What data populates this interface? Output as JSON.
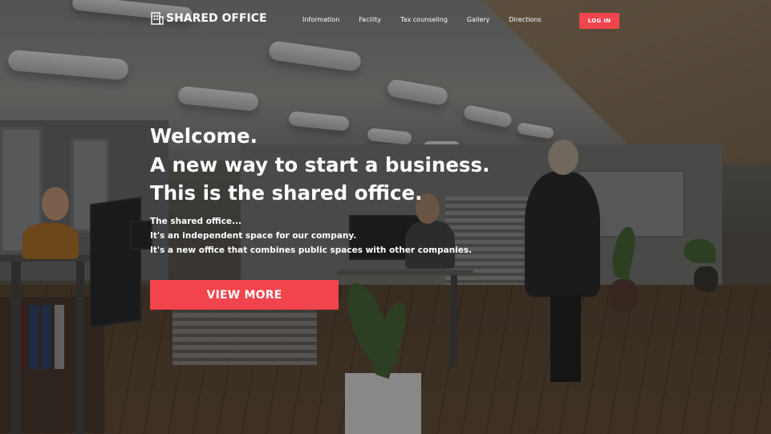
{
  "brand": {
    "name": "SHARED OFFICE",
    "icon": "building-icon"
  },
  "nav": {
    "items": [
      {
        "label": "Information"
      },
      {
        "label": "Facility"
      },
      {
        "label": "Tax counseling"
      },
      {
        "label": "Gallery"
      },
      {
        "label": "Directions"
      }
    ],
    "login_label": "LOG IN"
  },
  "hero": {
    "headline": [
      "Welcome.",
      "A new way to start a business.",
      "This is the shared office."
    ],
    "description": [
      "The shared office...",
      "It's an independent space for our company.",
      "It's a new office that combines public spaces with other companies."
    ],
    "cta_label": "VIEW MORE"
  },
  "colors": {
    "accent": "#f2444c",
    "text": "#ffffff"
  }
}
